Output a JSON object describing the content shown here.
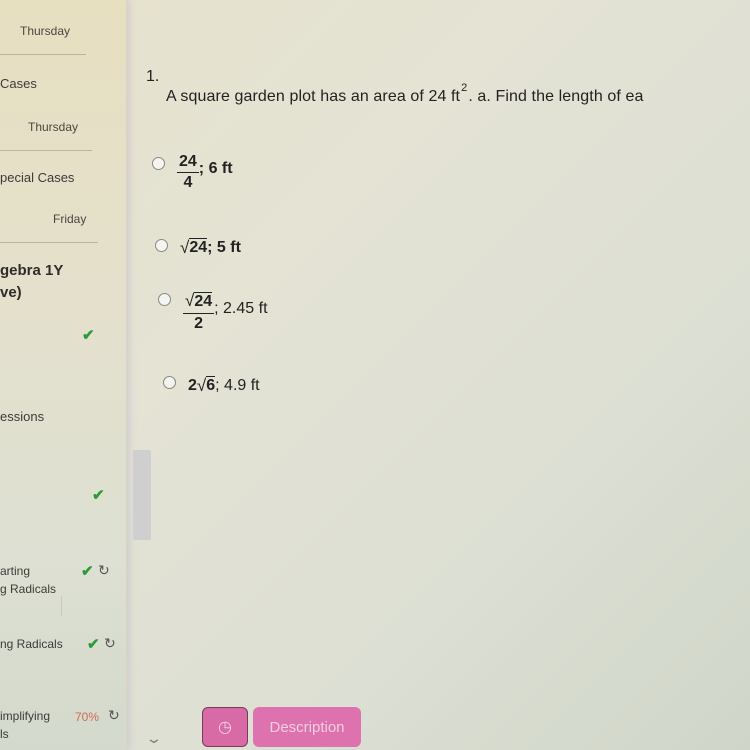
{
  "sidebar": {
    "items": [
      {
        "label": "",
        "date": "Thursday"
      },
      {
        "label": "Cases",
        "date": "Thursday"
      },
      {
        "label": "pecial Cases",
        "date": "Friday"
      }
    ],
    "section_title_line1": "gebra 1Y",
    "section_title_line2": "ve)",
    "lessons": [
      {
        "label": "",
        "status": "check"
      },
      {
        "label": "essions",
        "status": "check"
      },
      {
        "label_line1": "arting",
        "label_line2": "g Radicals",
        "status": "check"
      },
      {
        "label": "ng Radicals",
        "status": "check"
      },
      {
        "label_line1": "implifying",
        "label_line2": "ls",
        "status": "70%"
      }
    ],
    "check_glyph": "✔",
    "retry_glyph": "↻"
  },
  "question": {
    "number": "1.",
    "text_before": "A square garden plot has an area of 24 ft",
    "superscript": "2",
    "text_after": ". a. Find the length of ea",
    "options": [
      {
        "type": "fraction",
        "numerator": "24",
        "denominator": "4",
        "suffix": "; 6 ft"
      },
      {
        "type": "radical",
        "radical_symbol": "√",
        "radicand": "24",
        "suffix": "; 5 ft"
      },
      {
        "type": "fraction-radical",
        "radical_symbol": "√",
        "numerator": "24",
        "denominator": "2",
        "suffix": "; 2.45 ft"
      },
      {
        "type": "coef-radical",
        "coefficient": "2",
        "radical_symbol": "√",
        "radicand": "6",
        "suffix": "; 4.9 ft"
      }
    ]
  },
  "footer": {
    "timer_icon": "◷",
    "description_label": "Description",
    "chevron": "⌄"
  },
  "colors": {
    "accent_pink": "#de72ae",
    "check_green": "#2e9a3c",
    "percent_red": "#d06a5a"
  }
}
